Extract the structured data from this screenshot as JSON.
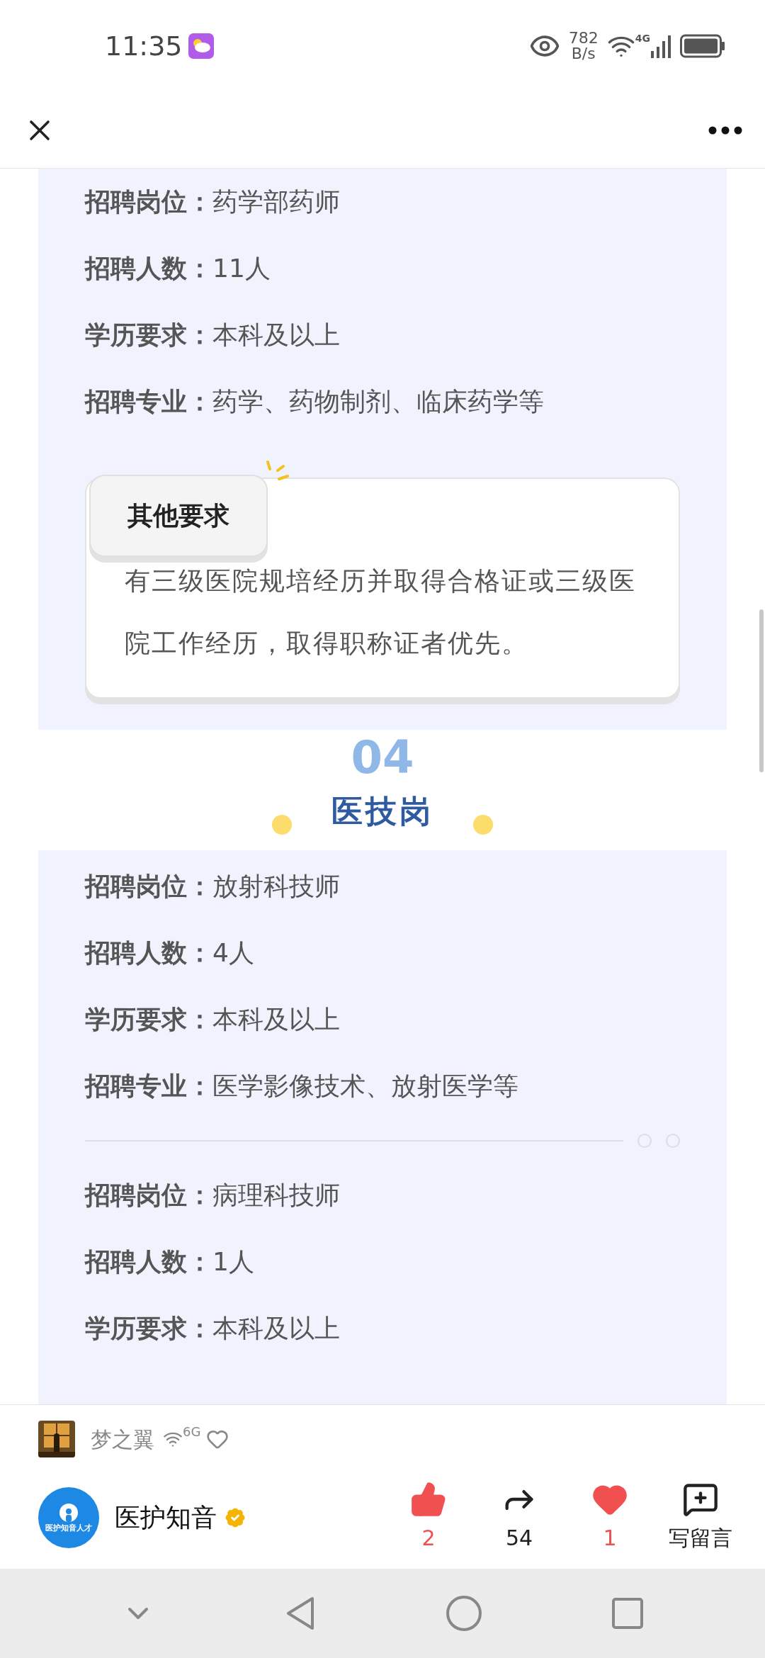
{
  "status_bar": {
    "time": "11:35",
    "net_speed": "782",
    "net_unit": "B/s",
    "network": "4G"
  },
  "first_card": {
    "rows": [
      {
        "label": "招聘岗位：",
        "value": "药学部药师"
      },
      {
        "label": "招聘人数：",
        "value": "11人"
      },
      {
        "label": "学历要求：",
        "value": "本科及以上"
      },
      {
        "label": "招聘专业：",
        "value": "药学、药物制剂、临床药学等"
      }
    ],
    "other_requirements": {
      "title": "其他要求",
      "text": "有三级医院规培经历并取得合格证或三级医院工作经历，取得职称证者优先。"
    }
  },
  "section": {
    "number": "04",
    "title": "医技岗"
  },
  "second_card": {
    "groups": [
      [
        {
          "label": "招聘岗位：",
          "value": "放射科技师"
        },
        {
          "label": "招聘人数：",
          "value": "4人"
        },
        {
          "label": "学历要求：",
          "value": "本科及以上"
        },
        {
          "label": "招聘专业：",
          "value": "医学影像技术、放射医学等"
        }
      ],
      [
        {
          "label": "招聘岗位：",
          "value": "病理科技师"
        },
        {
          "label": "招聘人数：",
          "value": "1人"
        },
        {
          "label": "学历要求：",
          "value": "本科及以上"
        }
      ]
    ]
  },
  "listener": {
    "name": "梦之翼",
    "signal": "6G",
    "liked": false
  },
  "account": {
    "name": "医护知音",
    "logo_text": "医护知音人才",
    "verified": true
  },
  "actions": [
    {
      "kind": "like",
      "label": "2",
      "on": true
    },
    {
      "kind": "share",
      "label": "54",
      "on": false
    },
    {
      "kind": "heart",
      "label": "1",
      "on": true
    },
    {
      "kind": "comment",
      "label": "写留言",
      "on": false
    }
  ]
}
